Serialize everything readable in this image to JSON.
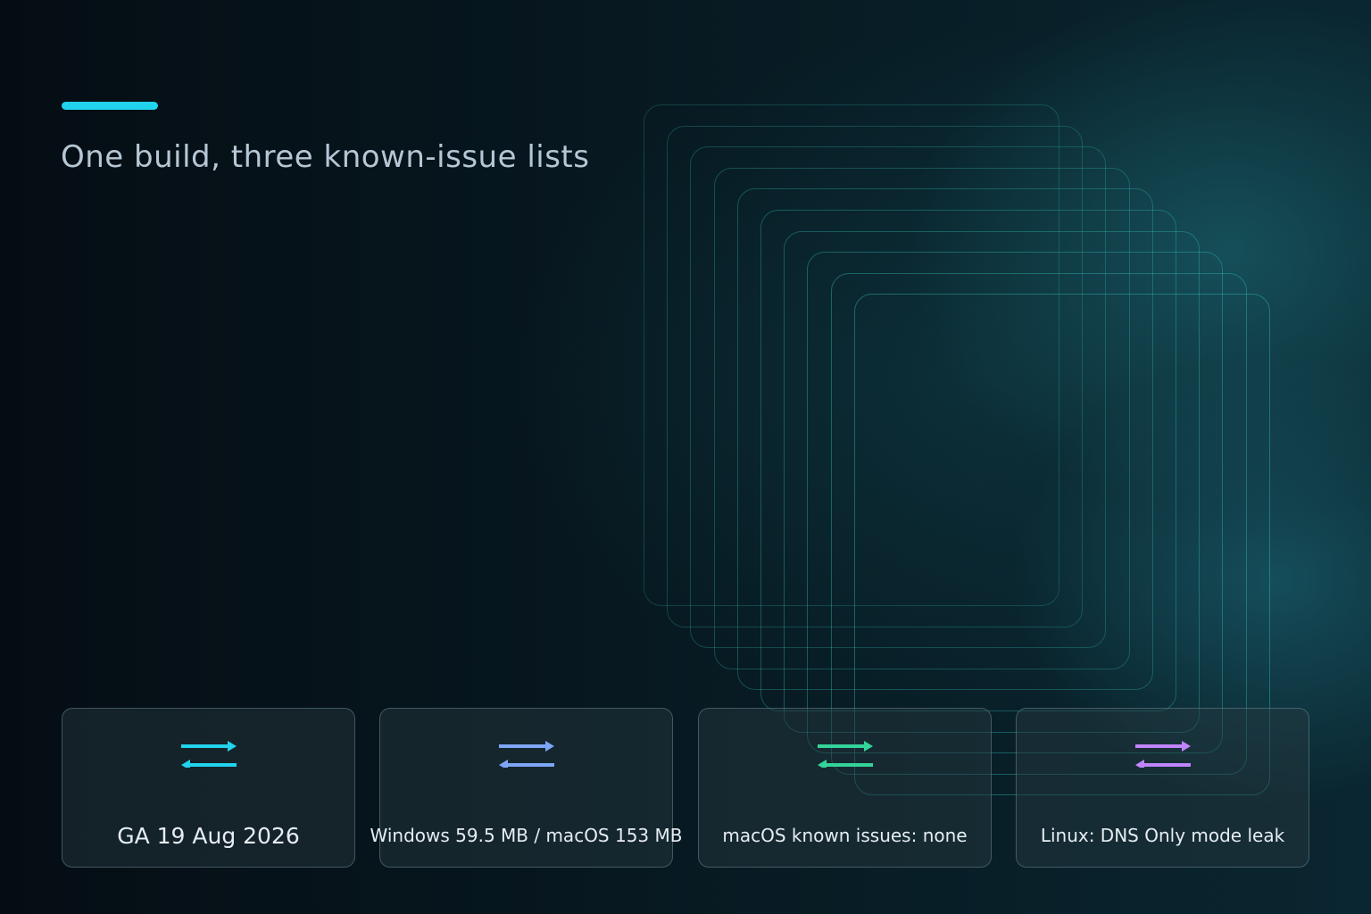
{
  "title": "One build, three known-issue lists",
  "accent_color": "#22d3ee",
  "cards": [
    {
      "label": "GA 19 Aug 2026",
      "icon": "swap-arrows-icon",
      "icon_color": "#22d3ee"
    },
    {
      "label": "Windows 59.5 MB / macOS 153 MB",
      "icon": "swap-arrows-icon",
      "icon_color": "#7ea6f7"
    },
    {
      "label": "macOS known issues: none",
      "icon": "swap-arrows-icon",
      "icon_color": "#34d399"
    },
    {
      "label": "Linux: DNS Only mode leak",
      "icon": "swap-arrows-icon",
      "icon_color": "#c084fc"
    }
  ]
}
